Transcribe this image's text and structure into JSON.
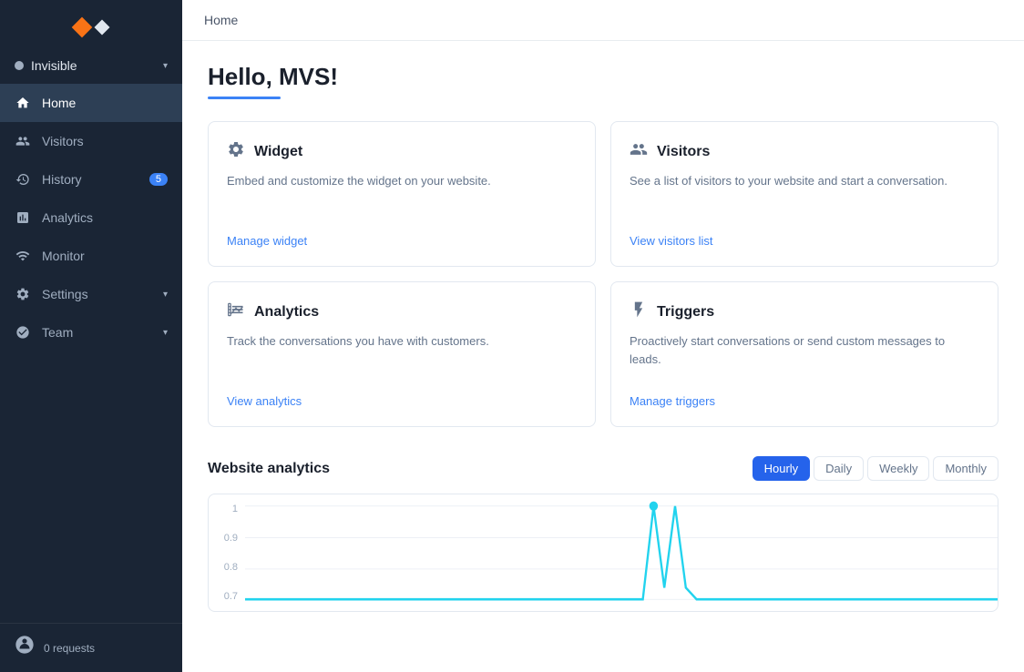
{
  "sidebar": {
    "logo": "chatwoot-logo",
    "workspace": {
      "name": "Invisible",
      "dot_color": "#a0aec0"
    },
    "nav_items": [
      {
        "id": "home",
        "label": "Home",
        "icon": "home",
        "active": true
      },
      {
        "id": "visitors",
        "label": "Visitors",
        "icon": "visitors",
        "active": false
      },
      {
        "id": "history",
        "label": "History",
        "icon": "history",
        "badge": "5",
        "active": false
      },
      {
        "id": "analytics",
        "label": "Analytics",
        "icon": "analytics",
        "active": false
      },
      {
        "id": "monitor",
        "label": "Monitor",
        "icon": "monitor",
        "active": false
      },
      {
        "id": "settings",
        "label": "Settings",
        "icon": "settings",
        "has_chevron": true,
        "active": false
      },
      {
        "id": "team",
        "label": "Team",
        "icon": "team",
        "has_chevron": true,
        "active": false
      }
    ],
    "bottom": {
      "requests_label": "0 requests"
    }
  },
  "topbar": {
    "title": "Home"
  },
  "main": {
    "greeting": "Hello, MVS!",
    "cards": [
      {
        "id": "widget",
        "icon": "⚙",
        "title": "Widget",
        "desc": "Embed and customize the widget on your website.",
        "link_label": "Manage widget"
      },
      {
        "id": "visitors",
        "icon": "👥",
        "title": "Visitors",
        "desc": "See a list of visitors to your website and start a conversation.",
        "link_label": "View visitors list"
      },
      {
        "id": "analytics",
        "icon": "📊",
        "title": "Analytics",
        "desc": "Track the conversations you have with customers.",
        "link_label": "View analytics"
      },
      {
        "id": "triggers",
        "icon": "⚡",
        "title": "Triggers",
        "desc": "Proactively start conversations or send custom messages to leads.",
        "link_label": "Manage triggers"
      }
    ],
    "website_analytics": {
      "title": "Website analytics",
      "time_filters": [
        {
          "id": "hourly",
          "label": "Hourly",
          "active": true
        },
        {
          "id": "daily",
          "label": "Daily",
          "active": false
        },
        {
          "id": "weekly",
          "label": "Weekly",
          "active": false
        },
        {
          "id": "monthly",
          "label": "Monthly",
          "active": false
        }
      ],
      "chart_y_labels": [
        "1",
        "0.9",
        "0.8",
        "0.7"
      ],
      "chart_color": "#22d3ee"
    }
  }
}
